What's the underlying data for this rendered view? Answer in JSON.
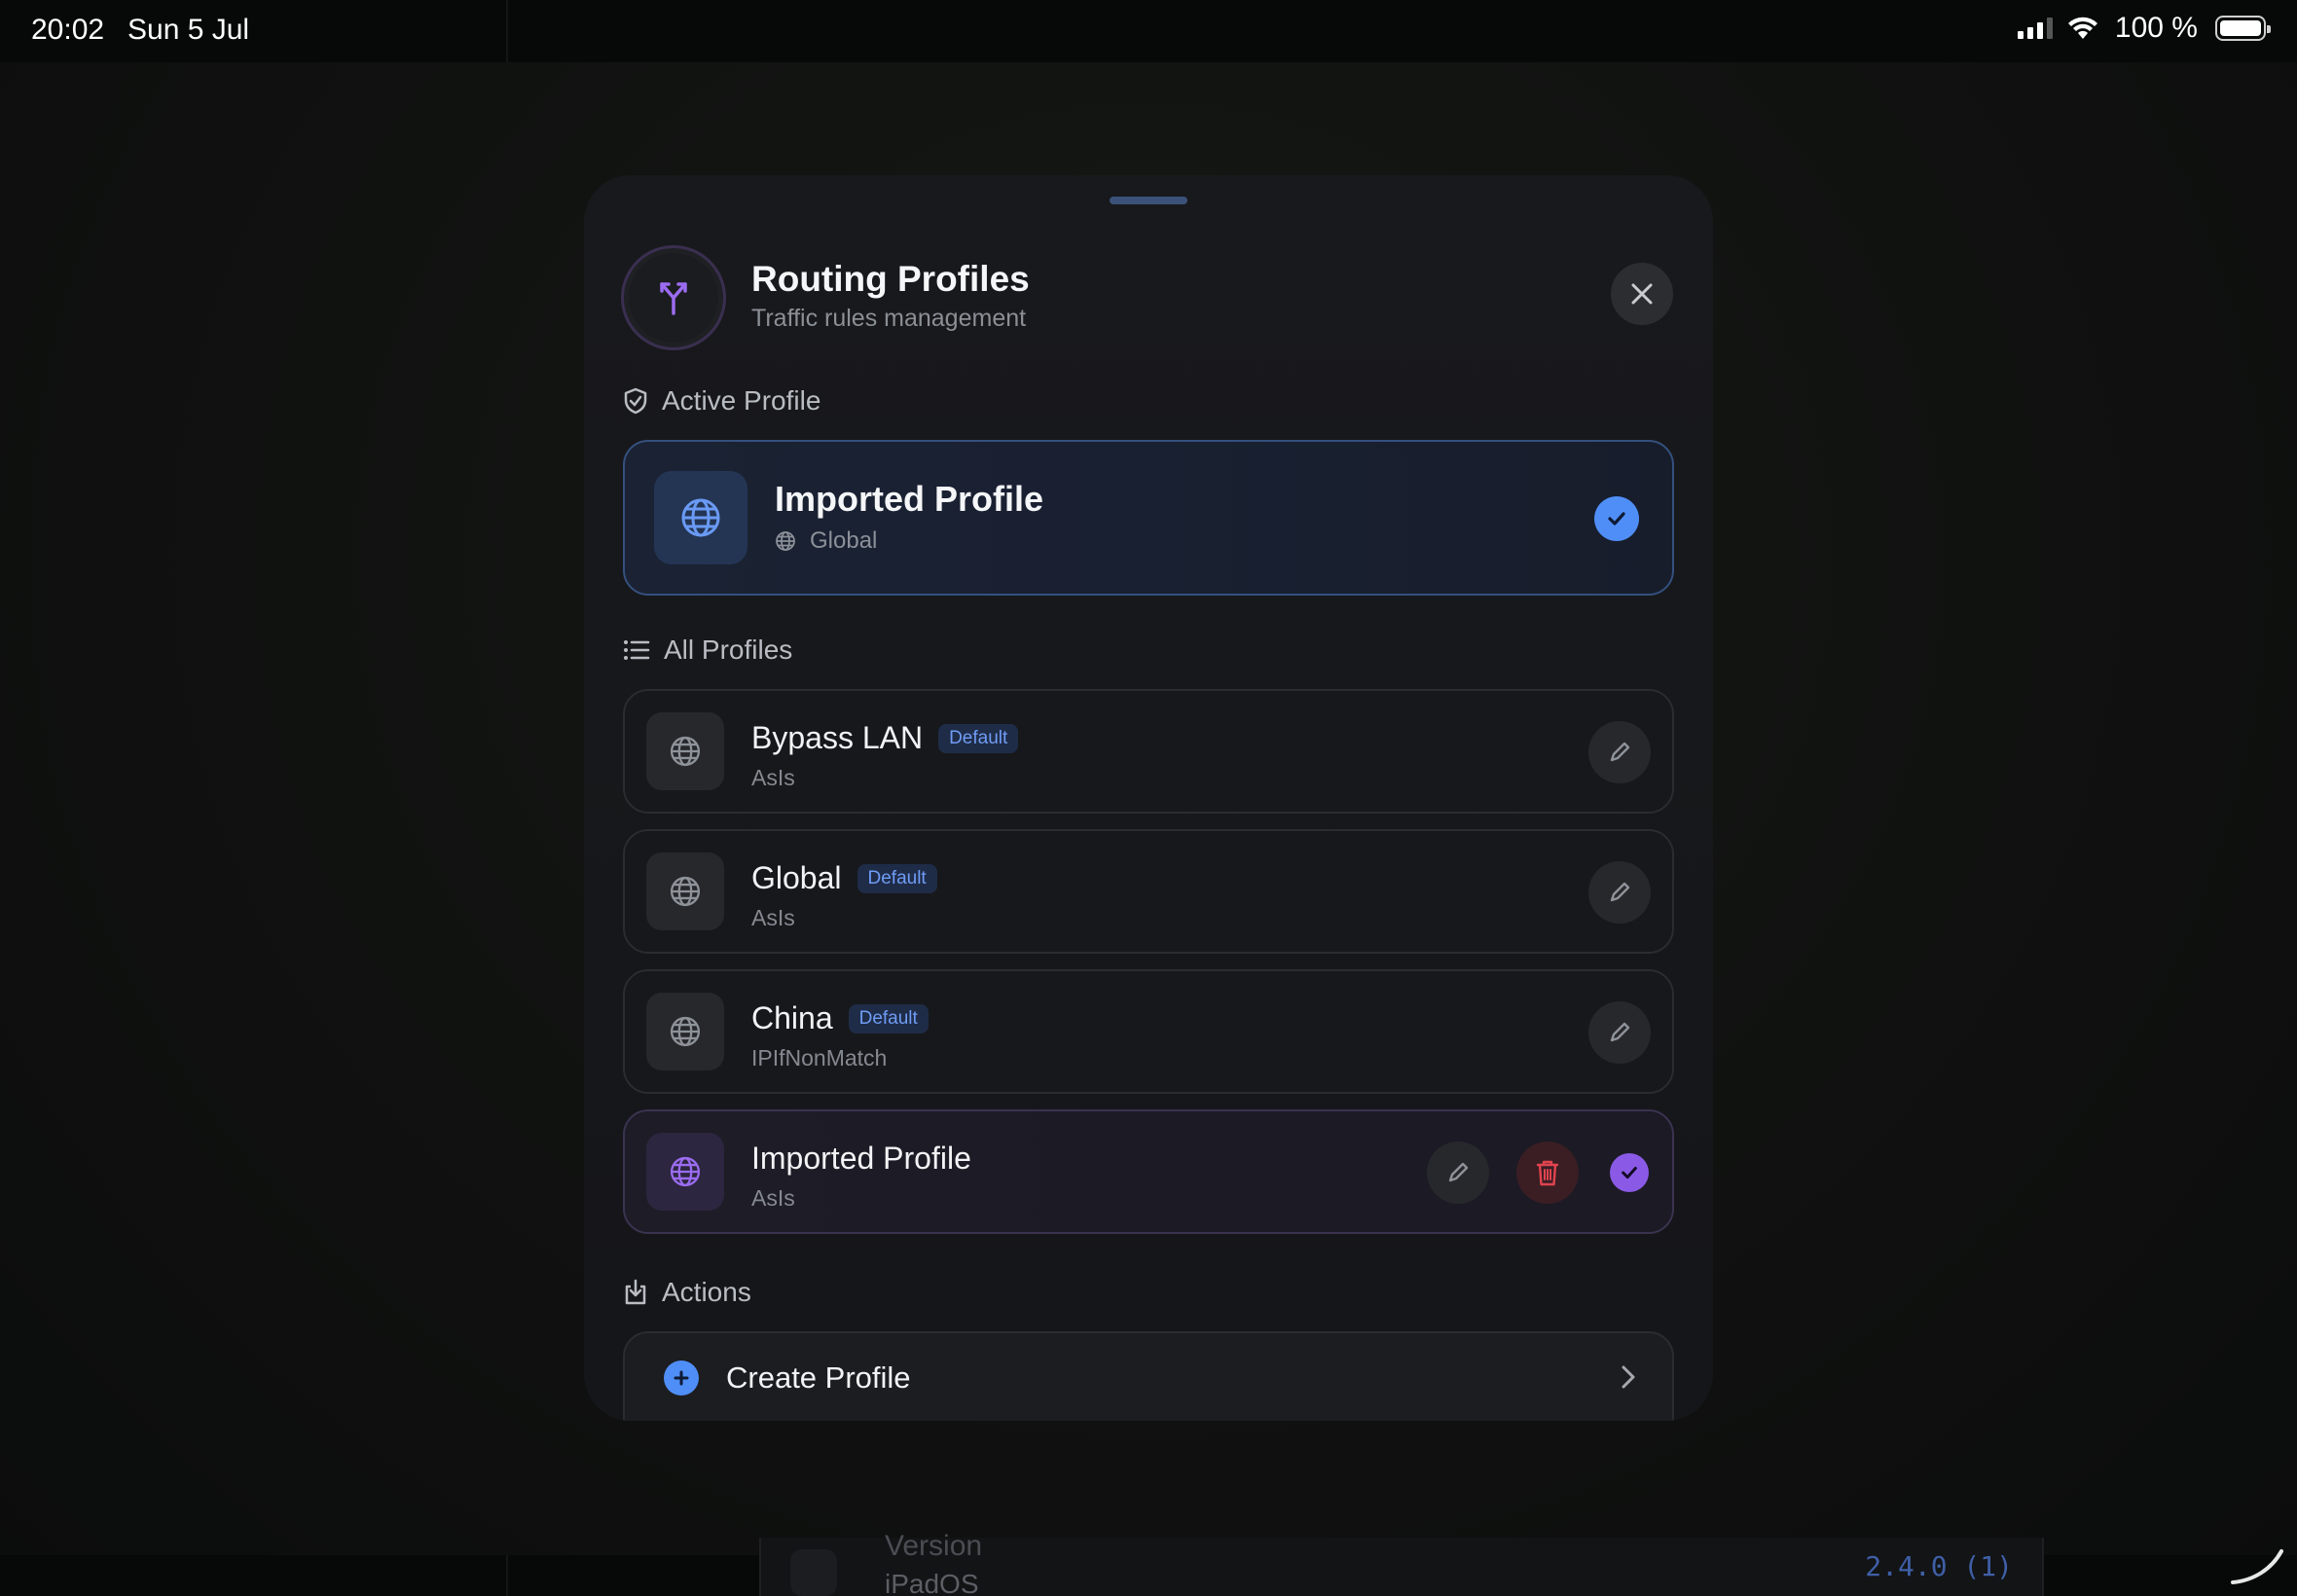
{
  "status_bar": {
    "time": "20:02",
    "date": "Sun 5 Jul",
    "battery_percent": "100 %"
  },
  "background": {
    "version_label": "Version",
    "os_label": "iPadOS",
    "version_value": "2.4.0 (1)"
  },
  "sheet": {
    "title": "Routing Profiles",
    "subtitle": "Traffic rules management",
    "header_icon": "fork-route-icon",
    "close_icon": "close-icon"
  },
  "active_section": {
    "label": "Active Profile",
    "icon": "shield-check-icon",
    "profile": {
      "name": "Imported Profile",
      "mode": "Global",
      "icon": "globe-icon",
      "selected": true
    }
  },
  "all_section": {
    "label": "All Profiles",
    "icon": "list-icon",
    "profiles": [
      {
        "name": "Bypass LAN",
        "badge": "Default",
        "strategy": "AsIs"
      },
      {
        "name": "Global",
        "badge": "Default",
        "strategy": "AsIs"
      },
      {
        "name": "China",
        "badge": "Default",
        "strategy": "IPIfNonMatch"
      },
      {
        "name": "Imported Profile",
        "badge": "",
        "strategy": "AsIs",
        "selected": true
      }
    ]
  },
  "actions_section": {
    "label": "Actions",
    "icon": "import-icon",
    "create_label": "Create Profile"
  },
  "colors": {
    "accent_blue": "#4f8ef7",
    "accent_purple": "#8a5ae6",
    "danger": "#e0444f"
  }
}
